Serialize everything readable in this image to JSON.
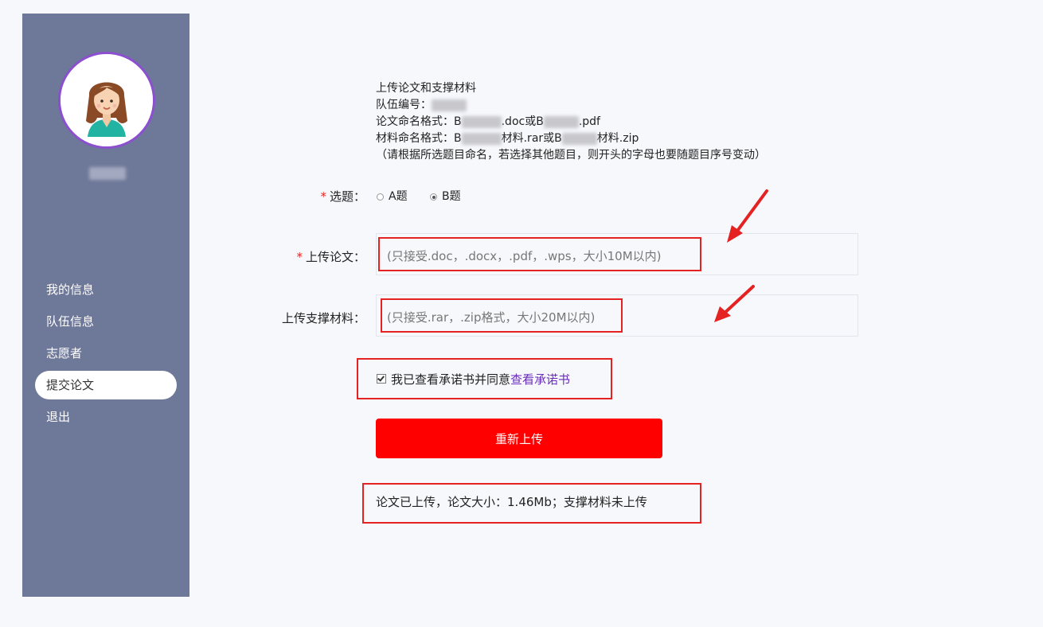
{
  "sidebar": {
    "avatar_icon": "girl-avatar-icon",
    "nav": [
      {
        "label": "我的信息"
      },
      {
        "label": "队伍信息"
      },
      {
        "label": "志愿者"
      },
      {
        "label": "提交论文",
        "active": true
      },
      {
        "label": "退出"
      }
    ]
  },
  "info": {
    "title": "上传论文和支撑材料",
    "team_label": "队伍编号：",
    "paper_format_label": "论文命名格式：",
    "paper_format_prefix": "B",
    "paper_format_mid": ".doc或B",
    "paper_format_suffix": ".pdf",
    "material_format_label": "材料命名格式：",
    "material_format_prefix": "B",
    "material_format_mid": "材料.rar或B",
    "material_format_suffix": "材料.zip",
    "note": "（请根据所选题目命名，若选择其他题目，则开头的字母也要随题目序号变动）"
  },
  "form": {
    "required_mark": "*",
    "topic_label": "选题：",
    "topic_options": [
      {
        "label": "A题",
        "selected": false
      },
      {
        "label": "B题",
        "selected": true
      }
    ],
    "paper_label": "上传论文：",
    "paper_hint": "(只接受.doc，.docx，.pdf，.wps，大小10M以内)",
    "material_label": "上传支撑材料：",
    "material_hint": "(只接受.rar，.zip格式，大小20M以内)",
    "agree_text": "我已查看承诺书并同意",
    "agree_link": "查看承诺书",
    "agree_checked": true,
    "submit_label": "重新上传",
    "status_text": "论文已上传，论文大小：1.46Mb；支撑材料未上传"
  },
  "colors": {
    "sidebar_bg": "#6e7898",
    "accent_red": "#ff0000",
    "highlight_red": "#e52222",
    "link_purple": "#6a2dbb",
    "avatar_ring": "#8b4fd0"
  }
}
